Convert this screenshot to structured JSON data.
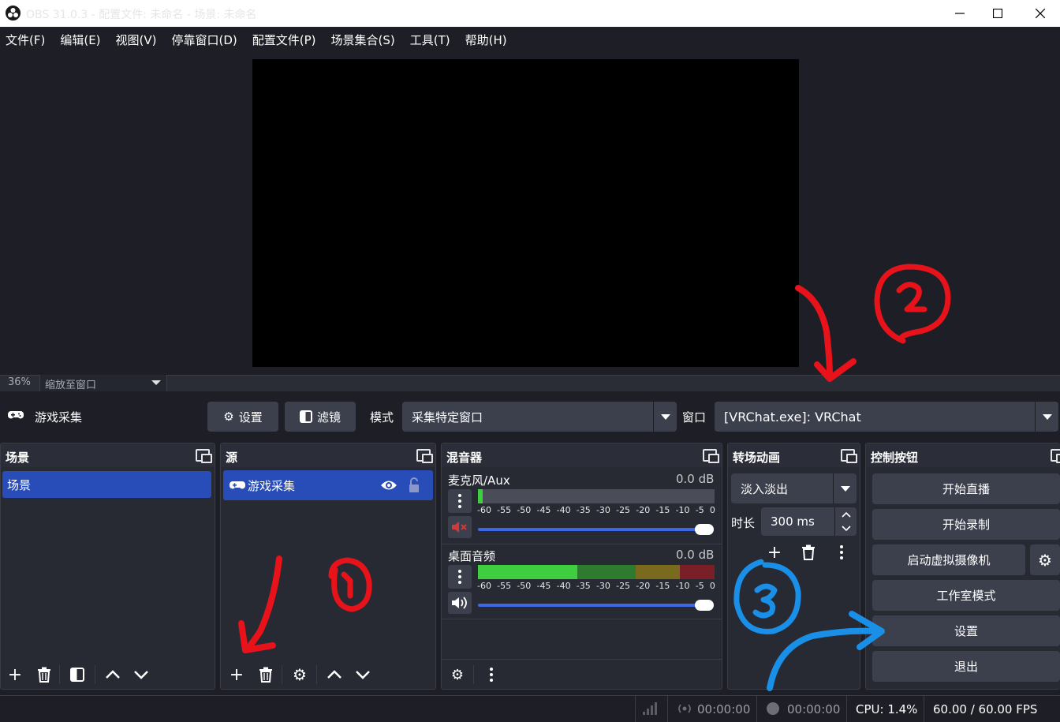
{
  "window": {
    "title": "OBS 31.0.3 - 配置文件: 未命名 - 场景: 未命名"
  },
  "menu": [
    "文件(F)",
    "编辑(E)",
    "视图(V)",
    "停靠窗口(D)",
    "配置文件(P)",
    "场景集合(S)",
    "工具(T)",
    "帮助(H)"
  ],
  "zoom": {
    "percent": "36%",
    "mode": "缩放至窗口"
  },
  "source_bar": {
    "source_name": "游戏采集",
    "settings_label": "设置",
    "filters_label": "滤镜",
    "mode_label": "模式",
    "mode_value": "采集特定窗口",
    "window_label": "窗口",
    "window_value": "[VRChat.exe]: VRChat"
  },
  "scenes": {
    "title": "场景",
    "items": [
      "场景"
    ]
  },
  "sources": {
    "title": "源",
    "items": [
      "游戏采集"
    ]
  },
  "mixer": {
    "title": "混音器",
    "ticks": [
      "-60",
      "-55",
      "-50",
      "-45",
      "-40",
      "-35",
      "-30",
      "-25",
      "-20",
      "-15",
      "-10",
      "-5",
      "0"
    ],
    "channels": [
      {
        "name": "麦克风/Aux",
        "level": "0.0 dB",
        "muted": true,
        "meter_fill": 0.02
      },
      {
        "name": "桌面音频",
        "level": "0.0 dB",
        "muted": false,
        "meter_fill": 0.42
      }
    ]
  },
  "transitions": {
    "title": "转场动画",
    "type": "淡入淡出",
    "duration_label": "时长",
    "duration_value": "300 ms"
  },
  "controls": {
    "title": "控制按钮",
    "start_stream": "开始直播",
    "start_record": "开始录制",
    "virtual_cam": "启动虚拟摄像机",
    "studio_mode": "工作室模式",
    "settings": "设置",
    "exit": "退出"
  },
  "status": {
    "stream_time": "00:00:00",
    "record_time": "00:00:00",
    "cpu": "CPU: 1.4%",
    "fps": "60.00 / 60.00 FPS"
  },
  "colors": {
    "accent": "#284cb8",
    "annot_red": "#e8121a",
    "annot_blue": "#1a8fe8"
  }
}
